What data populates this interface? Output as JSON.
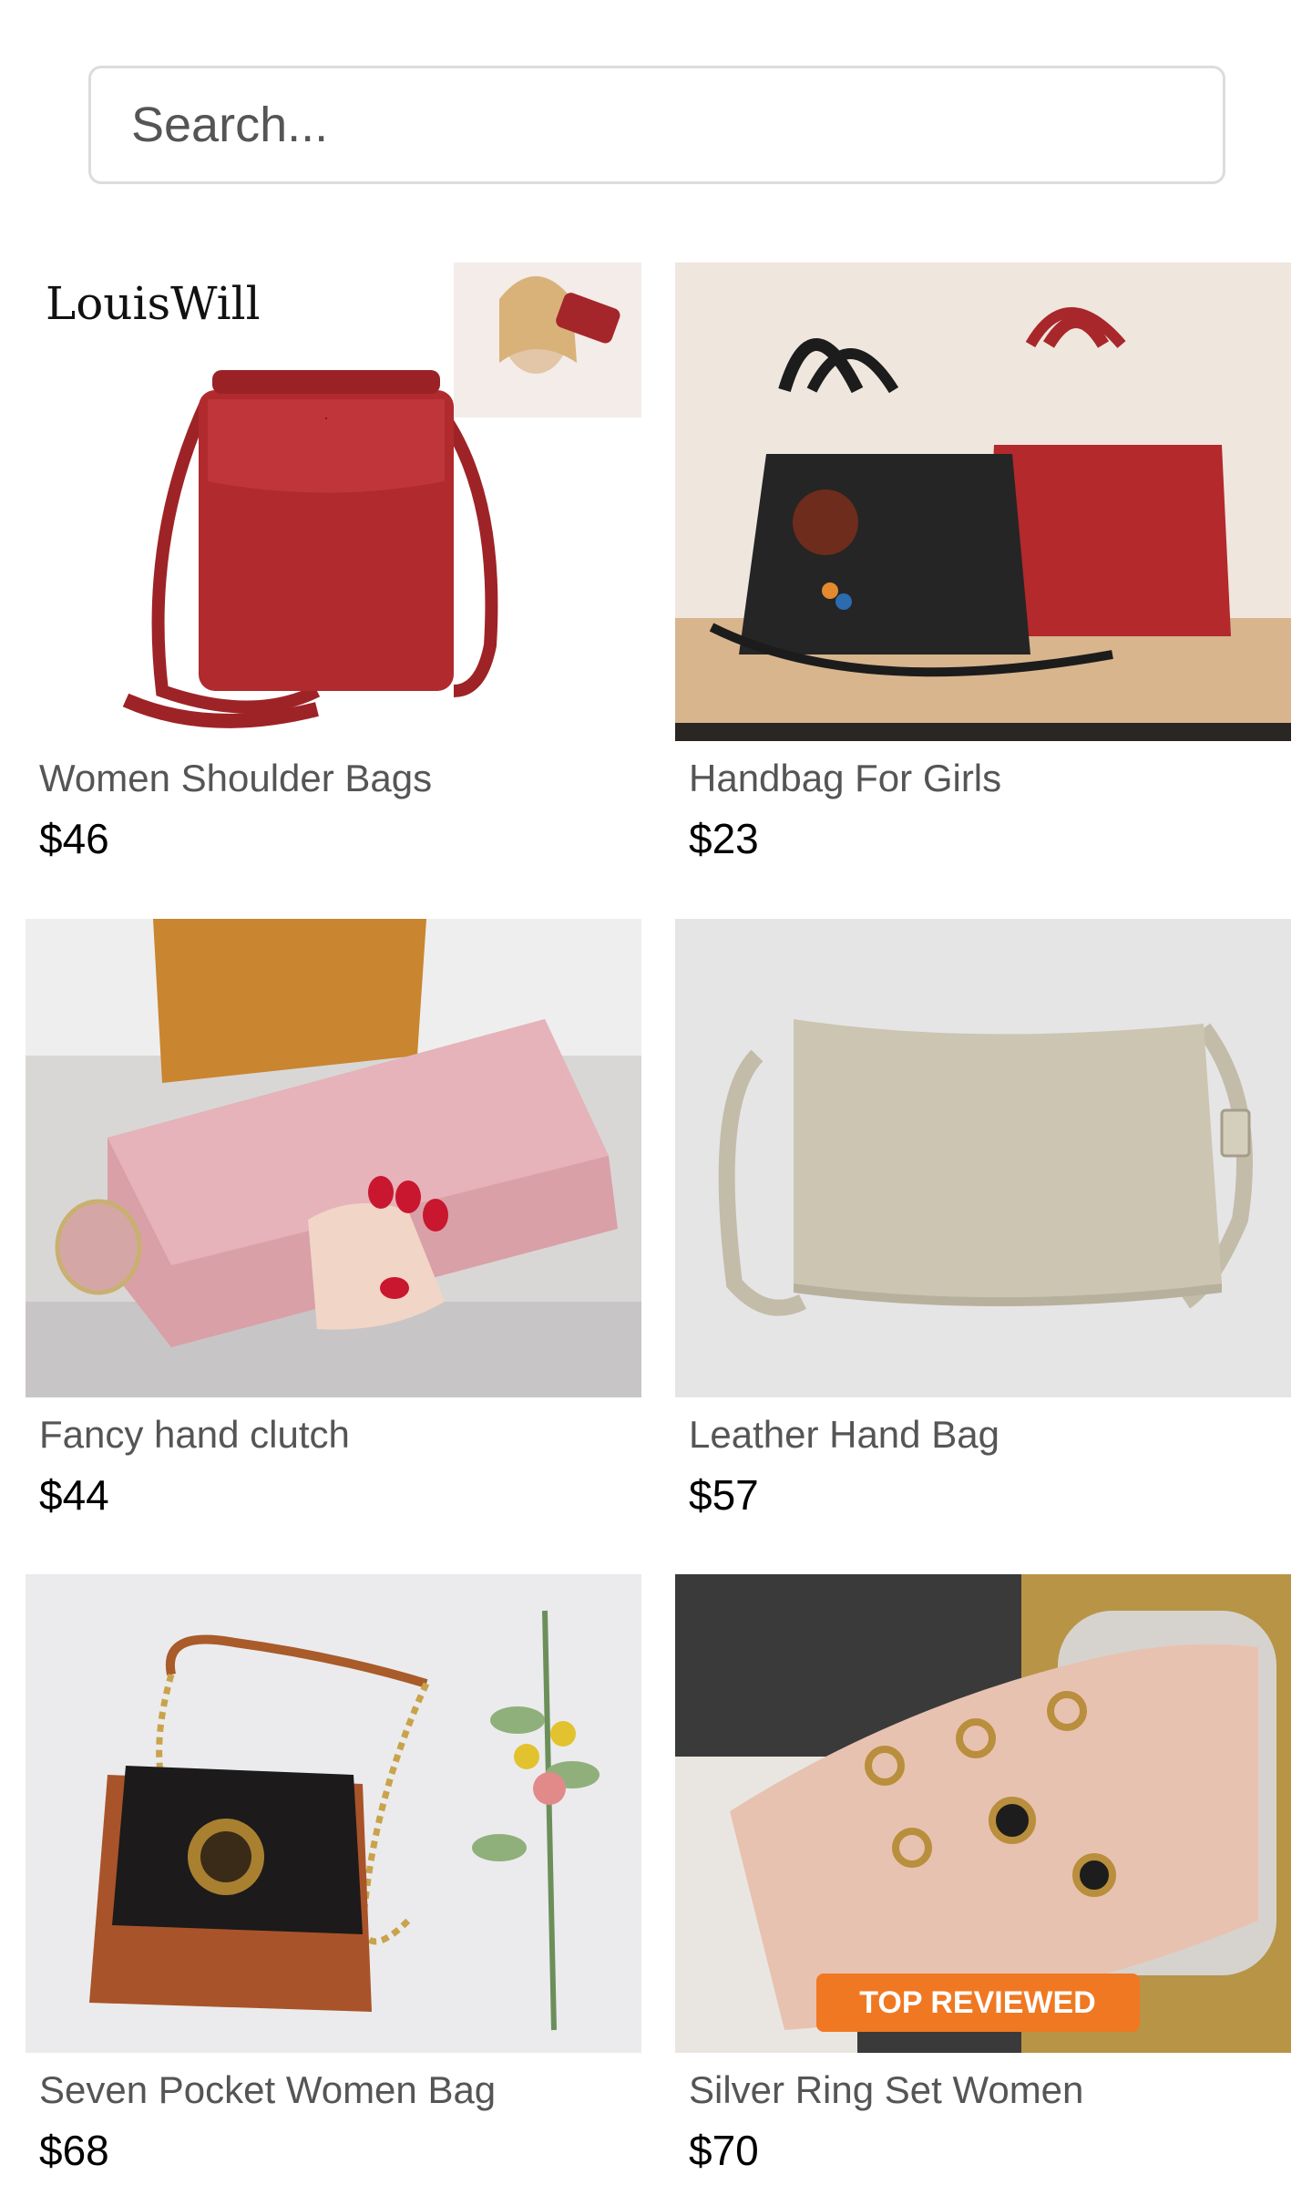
{
  "search": {
    "placeholder": "Search..."
  },
  "products": [
    {
      "title": "Women Shoulder Bags",
      "price": "$46",
      "brand_logo": "LouisWill"
    },
    {
      "title": "Handbag For Girls",
      "price": "$23"
    },
    {
      "title": "Fancy hand clutch",
      "price": "$44"
    },
    {
      "title": "Leather Hand Bag",
      "price": "$57"
    },
    {
      "title": "Seven Pocket Women Bag",
      "price": "$68"
    },
    {
      "title": "Silver Ring Set Women",
      "price": "$70",
      "badge": "TOP REVIEWED"
    }
  ]
}
